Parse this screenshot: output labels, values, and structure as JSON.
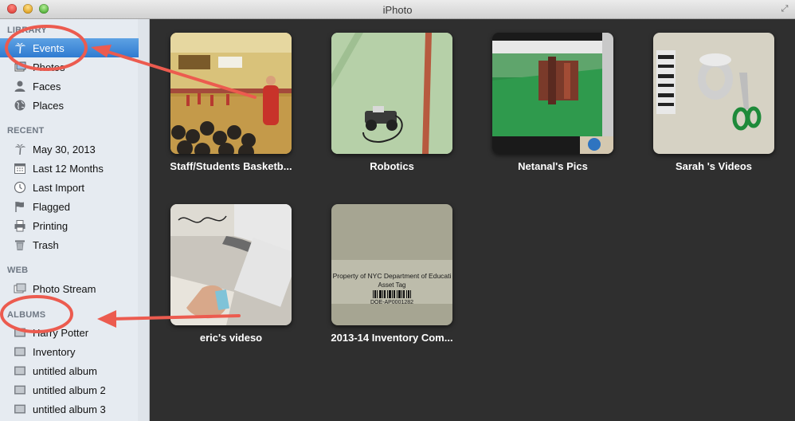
{
  "window": {
    "title": "iPhoto"
  },
  "sidebar": {
    "library_header": "LIBRARY",
    "library": [
      {
        "label": "Events",
        "icon": "palm-tree-icon",
        "selected": true
      },
      {
        "label": "Photos",
        "icon": "photos-icon"
      },
      {
        "label": "Faces",
        "icon": "faces-icon"
      },
      {
        "label": "Places",
        "icon": "globe-icon"
      }
    ],
    "recent_header": "RECENT",
    "recent": [
      {
        "label": "May 30, 2013",
        "icon": "palm-tree-icon"
      },
      {
        "label": "Last 12 Months",
        "icon": "calendar-icon"
      },
      {
        "label": "Last Import",
        "icon": "clock-icon"
      },
      {
        "label": "Flagged",
        "icon": "flag-icon"
      },
      {
        "label": "Printing",
        "icon": "printer-icon"
      },
      {
        "label": "Trash",
        "icon": "trash-icon"
      }
    ],
    "web_header": "WEB",
    "web": [
      {
        "label": "Photo Stream",
        "icon": "photo-stream-icon"
      }
    ],
    "albums_header": "ALBUMS",
    "albums": [
      {
        "label": "Harry Potter",
        "icon": "album-icon"
      },
      {
        "label": "Inventory",
        "icon": "album-icon"
      },
      {
        "label": "untitled album",
        "icon": "album-icon"
      },
      {
        "label": "untitled album 2",
        "icon": "album-icon"
      },
      {
        "label": "untitled album 3",
        "icon": "album-icon"
      }
    ]
  },
  "events": [
    {
      "title": "Staff/Students Basketb..."
    },
    {
      "title": "Robotics"
    },
    {
      "title": "Netanal's Pics"
    },
    {
      "title": "Sarah 's Videos"
    },
    {
      "title": "eric's videso"
    },
    {
      "title": "2013-14 Inventory Com..."
    }
  ],
  "photo_text": {
    "inventory_line1": "Property of NYC Department of Educati",
    "inventory_line2": "Asset Tag",
    "inventory_barcode": "DOE-AP0001282"
  },
  "colors": {
    "selection": "#3a86d6",
    "annotation": "#ec5b4f",
    "main_bg": "#2f2f2f",
    "sidebar_bg": "#e6ebf1"
  }
}
